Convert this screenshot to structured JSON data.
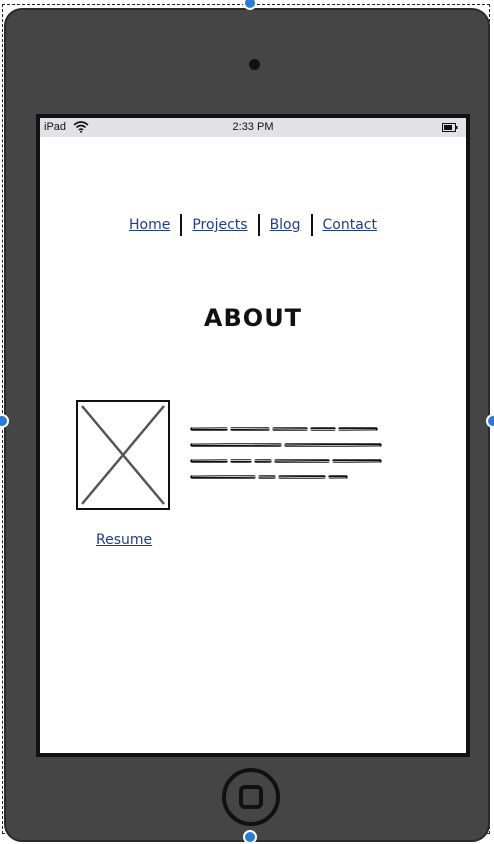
{
  "status_bar": {
    "carrier": "iPad",
    "time": "2:33 PM",
    "wifi_icon": "wifi-icon",
    "battery_icon": "battery-icon"
  },
  "nav": {
    "items": [
      {
        "label": "Home"
      },
      {
        "label": "Projects"
      },
      {
        "label": "Blog"
      },
      {
        "label": "Contact"
      }
    ]
  },
  "main": {
    "title": "ABOUT",
    "image_icon": "image-placeholder-icon",
    "resume_label": "Resume"
  },
  "colors": {
    "device_body": "#454545",
    "link": "#1f3d8a",
    "selection_handle": "#2b7bd6",
    "status_bar_bg": "#dfe3e6"
  }
}
